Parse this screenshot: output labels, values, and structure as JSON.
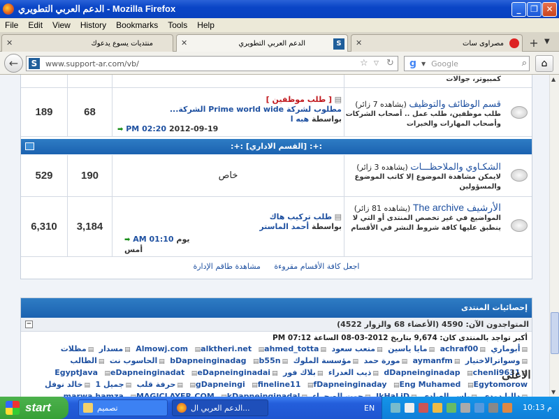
{
  "window": {
    "title": "الدعم العربي التطويري - Mozilla Firefox"
  },
  "menu": [
    "File",
    "Edit",
    "View",
    "History",
    "Bookmarks",
    "Tools",
    "Help"
  ],
  "tabs": [
    {
      "label": "منتديات يسوع يدعوك",
      "active": false
    },
    {
      "label": "الدعم العربي التطويري",
      "active": true
    },
    {
      "label": "مصراوى سات",
      "active": false
    }
  ],
  "nav": {
    "url": "www.support-ar.com/vb/",
    "search_placeholder": "Google"
  },
  "forums": {
    "top_partial": {
      "desc": "كمبيوتر، جوالات"
    },
    "jobs": {
      "name": "قسم الوظائف والتوظيف",
      "viewers": "(يشاهده 7 زائر)",
      "desc": "طلب موظفين، طلب عمل .. أصحاب الشركات وأصحاب المهارات والخبرات",
      "posts": "189",
      "threads": "68",
      "last_prefix": "[ طلب موظفين ]",
      "last_title": "مطلوب لشركة Prime world wide الشركة...",
      "last_by_label": "بواسطة",
      "last_by": "هبه ا",
      "last_date": "2012-09-19",
      "last_time": "PM 02:20"
    },
    "category": {
      "title": ":+: [القسم الاداري] :+:"
    },
    "complaints": {
      "name": "الشكـاوي والملاحظـــات",
      "viewers": "(يشاهده 3 زائر)",
      "desc": "لايمكن مشاهدة الموضوع إلا كاتب الموضوع والمسؤولين",
      "posts": "529",
      "threads": "190",
      "last_private": "خاص"
    },
    "archive": {
      "name": "الأرشيف The archive",
      "viewers": "(يشاهده 81 زائر)",
      "desc": "المواضيع في غير تخصص المنتدى أو التي لا ينطبق عليها كافة شروط النشر في الأقسام",
      "posts": "6,310",
      "threads": "3,184",
      "last_title": "طلب تركيب هاك",
      "last_by_label": "بواسطة",
      "last_by": "أحمد الماستر",
      "last_date": "يوم أمس",
      "last_time": "AM 01:10"
    },
    "footer_links": [
      "اجعل كافة الأقسام مقروءة",
      "مشاهدة طاقم الإدارة"
    ]
  },
  "stats": {
    "title": "إحصائيات المنتدى",
    "online": "المتواجدون الآن: 4590 (الأعضاء 68 والزوار 4522)",
    "record": "أكبر تواجد بالمنتدى كان: 9,674 بتاريخ 2012-03-08 الساعة PM 07:12",
    "members": [
      "أبوماري",
      "achraf00",
      "مايا ياسين",
      "متعب سعود",
      "Almowj.com",
      "alktheri.net",
      "ahmed_totta",
      "مسدار",
      "مظلات",
      "وسواترالاختيار",
      "aymanfm",
      "مورة حمد",
      "مؤسسة الملوك",
      "bDapneinginadag",
      "b55n",
      "الحاسوب نت",
      "الطالب",
      "dDapneinginadap",
      "chenli9631",
      "ذيب الغدراء",
      "بلاك فور",
      "EgyptJava",
      "eDapneinginadat",
      "eDapneinginadai",
      "gDapneingi",
      "fineline11",
      "fDapneinginaday",
      "Eng Muhamed",
      "Egytomorow",
      "حرفة قلب",
      "جميل 1",
      "خالد نوفل",
      "داليا دودي",
      "ياسر العبادي",
      "IkHaLiD",
      "جوت الصحراء",
      "marwa hamza",
      "MAGICLAYER.COM",
      "kDapneinginadal"
    ]
  },
  "watermark": "الاعلى",
  "taskbar": {
    "start": "start",
    "tasks": [
      "تصميم",
      "الدعم العربي ال..."
    ],
    "lang": "EN",
    "clock": "م 10:13"
  }
}
